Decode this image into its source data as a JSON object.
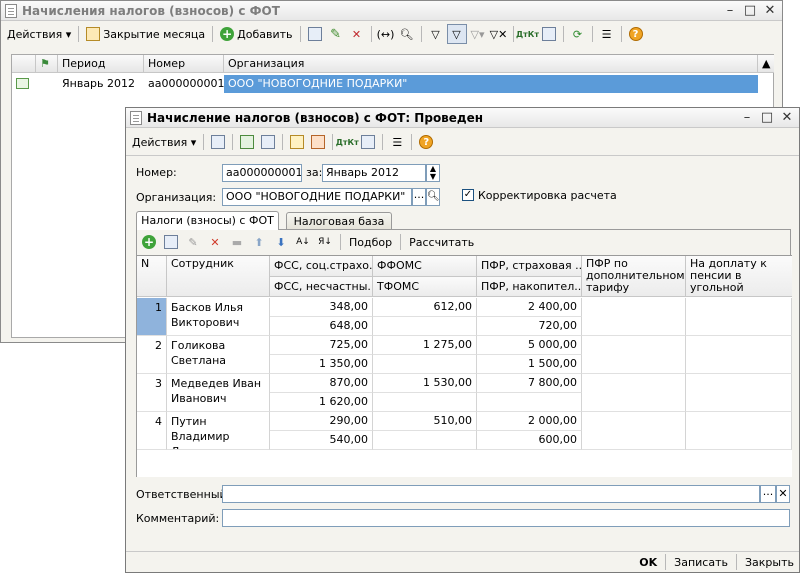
{
  "back_window": {
    "title": "Начисления налогов (взносов) с ФОТ",
    "toolbar": {
      "actions": "Действия",
      "close_month": "Закрытие месяца",
      "add": "Добавить"
    },
    "columns": [
      "Период",
      "Номер",
      "Организация"
    ],
    "rows": [
      {
        "period": "Январь 2012",
        "number": "аа000000001",
        "org": "ООО \"НОВОГОДНИЕ ПОДАРКИ\""
      }
    ]
  },
  "doc_window": {
    "title": "Начисление налогов (взносов) с ФОТ: Проведен",
    "toolbar": {
      "actions": "Действия"
    },
    "number_label": "Номер:",
    "number_value": "аа000000001",
    "for_label": "за:",
    "period_value": "Январь 2012",
    "org_label": "Организация:",
    "org_value": "ООО \"НОВОГОДНИЕ ПОДАРКИ\"",
    "correction_label": "Корректировка расчета",
    "tabs": [
      "Налоги (взносы) с ФОТ",
      "Налоговая база"
    ],
    "table_toolbar": {
      "pick": "Подбор",
      "calc": "Рассчитать"
    },
    "headers": {
      "n": "N",
      "employee": "Сотрудник",
      "fss1": "ФСС, соц.страхо...",
      "fss2": "ФСС, несчастны...",
      "ffoms": "ФФОМС",
      "tfoms": "ТФОМС",
      "pfr1": "ПФР, страховая ...",
      "pfr2": "ПФР, накопител...",
      "pfr_add": "ПФР по дополнительному тарифу",
      "coal": "На доплату к пенсии в угольной промышленности"
    },
    "rows": [
      {
        "n": "1",
        "name": "Басков Илья Викторович",
        "fss1": "348,00",
        "fss2": "648,00",
        "ffoms": "612,00",
        "tfoms": "",
        "pfr1": "2 400,00",
        "pfr2": "720,00"
      },
      {
        "n": "2",
        "name": "Голикова Светлана",
        "fss1": "725,00",
        "fss2": "1 350,00",
        "ffoms": "1 275,00",
        "tfoms": "",
        "pfr1": "5 000,00",
        "pfr2": "1 500,00"
      },
      {
        "n": "3",
        "name": "Медведев Иван Иванович",
        "fss1": "870,00",
        "fss2": "1 620,00",
        "ffoms": "1 530,00",
        "tfoms": "",
        "pfr1": "7 800,00",
        "pfr2": ""
      },
      {
        "n": "4",
        "name": "Путин Владимир Львович",
        "fss1": "290,00",
        "fss2": "540,00",
        "ffoms": "510,00",
        "tfoms": "",
        "pfr1": "2 000,00",
        "pfr2": "600,00"
      }
    ],
    "responsible_label": "Ответственный:",
    "comment_label": "Комментарий:",
    "footer": {
      "ok": "OK",
      "save": "Записать",
      "close": "Закрыть"
    }
  }
}
